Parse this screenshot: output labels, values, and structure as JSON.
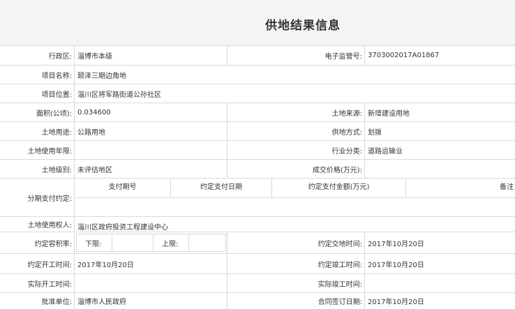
{
  "page": {
    "title": "供地结果信息"
  },
  "fields": {
    "district_label": "行政区:",
    "district_value": "淄博市本级",
    "supervision_no_label": "电子监管号:",
    "supervision_no_value": "3703002017A01867",
    "project_name_label": "项目名称:",
    "project_name_value": "颐泽三期边角地",
    "project_location_label": "项目位置:",
    "project_location_value": "淄川区将军路街道公孙社区",
    "area_label": "面积(公顷):",
    "area_value": "0.034600",
    "land_source_label": "土地来源:",
    "land_source_value": "新增建设用地",
    "land_use_label": "土地用途:",
    "land_use_value": "公路用地",
    "supply_method_label": "供地方式:",
    "supply_method_value": "划拨",
    "use_term_label": "土地使用年限:",
    "use_term_value": "",
    "industry_label": "行业分类:",
    "industry_value": "道路运输业",
    "land_grade_label": "土地级别:",
    "land_grade_value": "未评估地区",
    "price_label": "成交价格(万元):",
    "price_value": "",
    "installment_label": "分期支付约定:",
    "installment_headers": {
      "period": "支付期号",
      "date": "约定支付日期",
      "amount": "约定支付金额(万元)",
      "remark": "备注"
    },
    "right_holder_label": "土地使用权人:",
    "right_holder_value": "淄川区政府投资工程建设中心",
    "far_label": "约定容积率:",
    "far_lower_label": "下限:",
    "far_lower_value": "",
    "far_upper_label": "上限:",
    "far_upper_value": "",
    "delivery_date_label": "约定交地时间:",
    "delivery_date_value": "2017年10月20日",
    "start_date_label": "约定开工时间:",
    "start_date_value": "2017年10月20日",
    "completion_date_label": "约定竣工时间:",
    "completion_date_value": "2017年10月20日",
    "actual_start_label": "实际开工时间:",
    "actual_start_value": "",
    "actual_completion_label": "实际竣工时间:",
    "actual_completion_value": "",
    "approver_label": "批准单位:",
    "approver_value": "淄博市人民政府",
    "contract_date_label": "合同签订日期:",
    "contract_date_value": "2017年10月20日"
  }
}
